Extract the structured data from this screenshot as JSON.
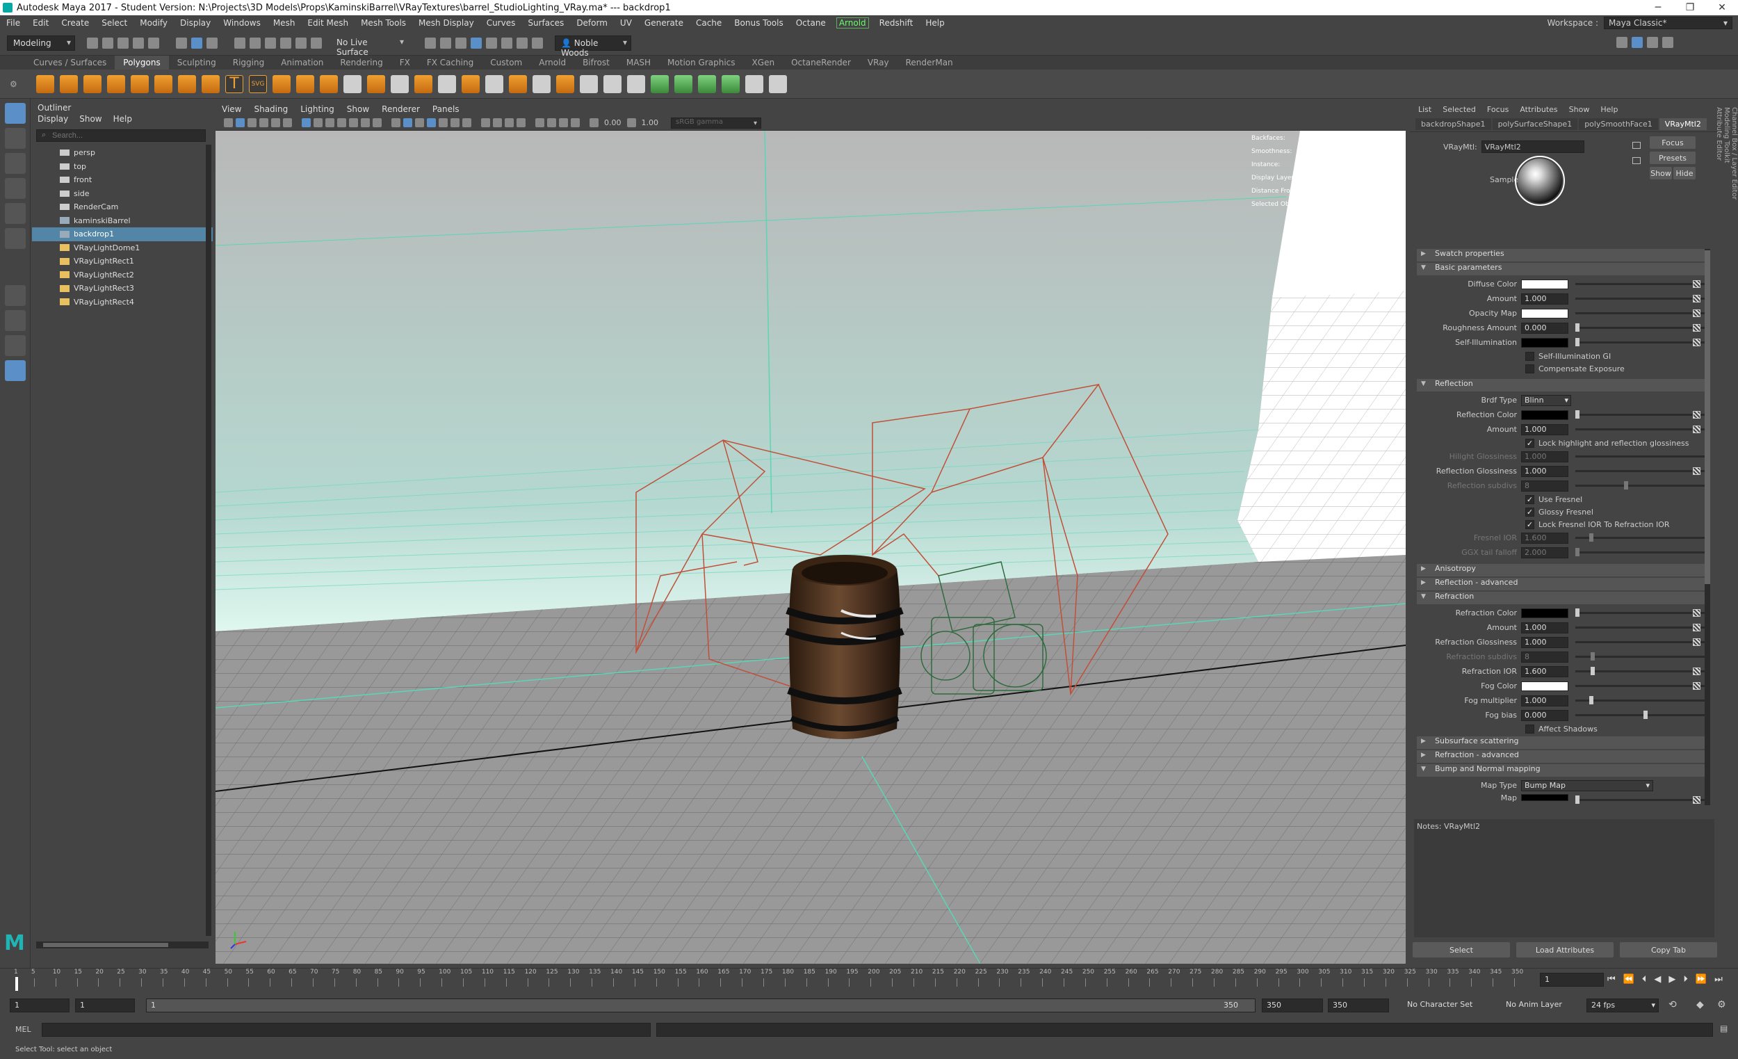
{
  "titlebar": {
    "title": "Autodesk Maya 2017 - Student Version: N:\\Projects\\3D Models\\Props\\KaminskiBarrel\\VRayTextures\\barrel_StudioLighting_VRay.ma*   ---   backdrop1"
  },
  "menubar": {
    "items": [
      "File",
      "Edit",
      "Create",
      "Select",
      "Modify",
      "Display",
      "Windows",
      "Mesh",
      "Edit Mesh",
      "Mesh Tools",
      "Mesh Display",
      "Curves",
      "Surfaces",
      "Deform",
      "UV",
      "Generate",
      "Cache",
      "Bonus Tools",
      "Octane",
      "Arnold",
      "Redshift",
      "Help"
    ],
    "highlighted": "Arnold"
  },
  "workspace": {
    "label": "Workspace :",
    "value": "Maya Classic*"
  },
  "statusline": {
    "mode": "Modeling",
    "live_surface": "No Live Surface",
    "user": "Noble Woods"
  },
  "shelf": {
    "tabs": [
      "Curves / Surfaces",
      "Polygons",
      "Sculpting",
      "Rigging",
      "Animation",
      "Rendering",
      "FX",
      "FX Caching",
      "Custom",
      "Arnold",
      "Bifrost",
      "MASH",
      "Motion Graphics",
      "XGen",
      "OctaneRender",
      "VRay",
      "RenderMan"
    ],
    "active_tab": "Polygons",
    "text_tool": "T",
    "svg_tool": "SVG"
  },
  "outliner": {
    "title": "Outliner",
    "menu": [
      "Display",
      "Show",
      "Help"
    ],
    "search_placeholder": "Search...",
    "items": [
      {
        "label": "persp",
        "icon": "camera-icon"
      },
      {
        "label": "top",
        "icon": "camera-icon"
      },
      {
        "label": "front",
        "icon": "camera-icon"
      },
      {
        "label": "side",
        "icon": "camera-icon"
      },
      {
        "label": "RenderCam",
        "icon": "camera-icon"
      },
      {
        "label": "kaminskiBarrel",
        "icon": "mesh-icon"
      },
      {
        "label": "backdrop1",
        "icon": "mesh-icon"
      },
      {
        "label": "VRayLightDome1",
        "icon": "light-icon"
      },
      {
        "label": "VRayLightRect1",
        "icon": "light-icon"
      },
      {
        "label": "VRayLightRect2",
        "icon": "light-icon"
      },
      {
        "label": "VRayLightRect3",
        "icon": "light-icon"
      },
      {
        "label": "VRayLightRect4",
        "icon": "light-icon"
      }
    ],
    "selected": "backdrop1"
  },
  "viewport": {
    "menu": [
      "View",
      "Shading",
      "Lighting",
      "Show",
      "Renderer",
      "Panels"
    ],
    "exposure": "0.00",
    "gamma": "1.00",
    "colorspace": "sRGB gamma",
    "hud": [
      "Backfaces:",
      "Smoothness:",
      "Instance:",
      "Display Layer:",
      "Distance From Camera:",
      "Selected Objects:"
    ]
  },
  "attr_editor": {
    "menu": [
      "List",
      "Selected",
      "Focus",
      "Attributes",
      "Show",
      "Help"
    ],
    "node_tabs": [
      "backdropShape1",
      "polySurfaceShape1",
      "polySmoothFace1",
      "VRayMtl2"
    ],
    "active_tab": "VRayMtl2",
    "type_label": "VRayMtl:",
    "node_name": "VRayMtl2",
    "buttons": {
      "focus": "Focus",
      "presets": "Presets",
      "show": "Show",
      "hide": "Hide"
    },
    "sample_label": "Sample",
    "sections": {
      "swatch": "Swatch properties",
      "basic": "Basic parameters",
      "reflection": "Reflection",
      "anisotropy": "Anisotropy",
      "refl_adv": "Reflection - advanced",
      "refraction": "Refraction",
      "sss": "Subsurface scattering",
      "refr_adv": "Refraction - advanced",
      "bump": "Bump and Normal mapping"
    },
    "basic": {
      "diffuse_color": "Diffuse Color",
      "amount_label": "Amount",
      "amount": "1.000",
      "opacity_map": "Opacity Map",
      "roughness_label": "Roughness Amount",
      "roughness": "0.000",
      "self_illum": "Self-Illumination",
      "self_illum_gi": "Self-Illumination GI",
      "compensate": "Compensate Exposure"
    },
    "reflection": {
      "brdf_label": "Brdf Type",
      "brdf": "Blinn",
      "refl_color": "Reflection Color",
      "amount_label": "Amount",
      "amount": "1.000",
      "lock_hilight": "Lock highlight and reflection glossiness",
      "hilight_label": "Hilight Glossiness",
      "hilight": "1.000",
      "gloss_label": "Reflection Glossiness",
      "gloss": "1.000",
      "subdivs_label": "Reflection subdivs",
      "subdivs": "8",
      "use_fresnel": "Use Fresnel",
      "glossy_fresnel": "Glossy Fresnel",
      "lock_ior": "Lock Fresnel IOR To Refraction IOR",
      "fresnel_ior_label": "Fresnel IOR",
      "fresnel_ior": "1.600",
      "ggx_label": "GGX tail falloff",
      "ggx": "2.000"
    },
    "refraction": {
      "color_label": "Refraction Color",
      "amount_label": "Amount",
      "amount": "1.000",
      "gloss_label": "Refraction Glossiness",
      "gloss": "1.000",
      "subdivs_label": "Refraction subdivs",
      "subdivs": "8",
      "ior_label": "Refraction IOR",
      "ior": "1.600",
      "fog_color": "Fog Color",
      "fog_mult_label": "Fog multiplier",
      "fog_mult": "1.000",
      "fog_bias_label": "Fog bias",
      "fog_bias": "0.000",
      "affect_shadows": "Affect Shadows"
    },
    "bump": {
      "map_type_label": "Map Type",
      "map_type": "Bump Map",
      "map_label": "Map"
    },
    "notes": "Notes:  VRayMtl2",
    "bottom_buttons": [
      "Select",
      "Load Attributes",
      "Copy Tab"
    ],
    "side_tabs": [
      "Channel Box / Layer Editor",
      "Modeling Toolkit",
      "Attribute Editor"
    ]
  },
  "timeline": {
    "ticks": [
      "5",
      "10",
      "15",
      "20",
      "25",
      "30",
      "35",
      "40",
      "45",
      "50",
      "55",
      "60",
      "65",
      "70",
      "75",
      "80",
      "85",
      "90",
      "95",
      "100",
      "105",
      "110",
      "115",
      "120",
      "125",
      "130",
      "135",
      "140",
      "145",
      "150",
      "155",
      "160",
      "165",
      "170",
      "175",
      "180",
      "185",
      "190",
      "195",
      "200",
      "205",
      "210",
      "215",
      "220",
      "225",
      "230",
      "235",
      "240",
      "245",
      "250",
      "255",
      "260",
      "265",
      "270",
      "275",
      "280",
      "285",
      "290",
      "295",
      "300",
      "305",
      "310",
      "315",
      "320",
      "325",
      "330",
      "335",
      "340",
      "345",
      "350"
    ],
    "start_tick": "1",
    "current_frame": "1"
  },
  "range": {
    "start": "1",
    "anim_start": "1",
    "slider_start": "1",
    "slider_end": "350",
    "anim_end": "350",
    "end": "350",
    "character_set": "No Character Set",
    "anim_layer": "No Anim Layer",
    "fps": "24 fps"
  },
  "cmdline": {
    "lang": "MEL"
  },
  "helpline": {
    "text": "Select Tool: select an object"
  }
}
